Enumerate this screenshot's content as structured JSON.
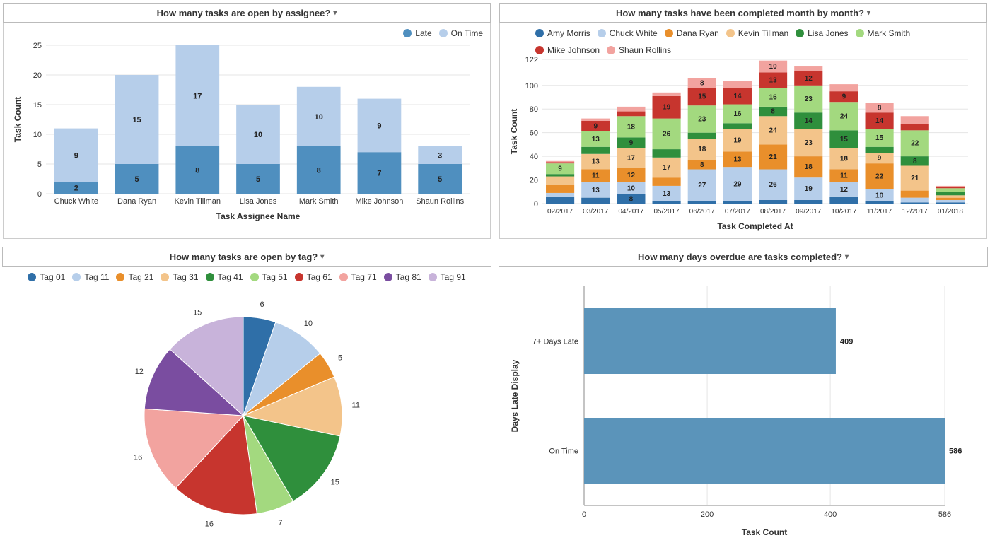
{
  "panels": {
    "byAssignee": {
      "title": "How many tasks are open by assignee?"
    },
    "byMonth": {
      "title": "How many tasks have been completed month by month?"
    },
    "byTag": {
      "title": "How many tasks are open by tag?"
    },
    "overdue": {
      "title": "How many days overdue are tasks completed?"
    }
  },
  "chart_data": [
    {
      "id": "byAssignee",
      "type": "bar-stacked",
      "xlabel": "Task Assignee Name",
      "ylabel": "Task Count",
      "ylim": [
        0,
        25
      ],
      "yticks": [
        0,
        5,
        10,
        15,
        20,
        25
      ],
      "categories": [
        "Chuck White",
        "Dana Ryan",
        "Kevin Tillman",
        "Lisa Jones",
        "Mark Smith",
        "Mike Johnson",
        "Shaun Rollins"
      ],
      "series": [
        {
          "name": "Late",
          "color": "#4f8fbf",
          "values": [
            2,
            5,
            8,
            5,
            8,
            7,
            5
          ]
        },
        {
          "name": "On Time",
          "color": "#b6ceea",
          "values": [
            9,
            15,
            17,
            10,
            10,
            9,
            3
          ]
        }
      ]
    },
    {
      "id": "byMonth",
      "type": "bar-stacked",
      "xlabel": "Task Completed At",
      "ylabel": "Task Count",
      "ylim": [
        0,
        122
      ],
      "yticks": [
        0,
        20,
        40,
        60,
        80,
        100,
        122
      ],
      "categories": [
        "02/2017",
        "03/2017",
        "04/2017",
        "05/2017",
        "06/2017",
        "07/2017",
        "08/2017",
        "09/2017",
        "10/2017",
        "11/2017",
        "12/2017",
        "01/2018"
      ],
      "series": [
        {
          "name": "Amy Morris",
          "color": "#2f6fa8",
          "values": [
            6,
            5,
            8,
            2,
            2,
            2,
            3,
            3,
            6,
            2,
            1,
            1
          ]
        },
        {
          "name": "Chuck White",
          "color": "#b6ceea",
          "values": [
            3,
            13,
            10,
            13,
            27,
            29,
            26,
            19,
            12,
            10,
            4,
            2
          ]
        },
        {
          "name": "Dana Ryan",
          "color": "#e98f2b",
          "values": [
            7,
            11,
            12,
            7,
            8,
            13,
            21,
            18,
            11,
            22,
            6,
            2
          ]
        },
        {
          "name": "Kevin Tillman",
          "color": "#f3c48a",
          "values": [
            7,
            13,
            17,
            17,
            18,
            19,
            24,
            23,
            18,
            9,
            21,
            2
          ]
        },
        {
          "name": "Lisa Jones",
          "color": "#2f8f3c",
          "values": [
            2,
            6,
            9,
            7,
            5,
            5,
            8,
            14,
            15,
            5,
            8,
            3
          ]
        },
        {
          "name": "Mark Smith",
          "color": "#a3d97f",
          "values": [
            9,
            13,
            18,
            26,
            23,
            16,
            16,
            23,
            24,
            15,
            22,
            3
          ]
        },
        {
          "name": "Mike Johnson",
          "color": "#c7352e",
          "values": [
            1,
            9,
            4,
            19,
            15,
            14,
            13,
            12,
            9,
            14,
            5,
            1
          ]
        },
        {
          "name": "Shaun Rollins",
          "color": "#f2a39f",
          "values": [
            1,
            2,
            4,
            3,
            8,
            6,
            10,
            4,
            6,
            8,
            7,
            1
          ]
        }
      ]
    },
    {
      "id": "byTag",
      "type": "pie",
      "series": [
        {
          "name": "Tag 01",
          "color": "#2f6fa8",
          "value": 6
        },
        {
          "name": "Tag 11",
          "color": "#b6ceea",
          "value": 10
        },
        {
          "name": "Tag 21",
          "color": "#e98f2b",
          "value": 5
        },
        {
          "name": "Tag 31",
          "color": "#f3c48a",
          "value": 11
        },
        {
          "name": "Tag 41",
          "color": "#2f8f3c",
          "value": 15
        },
        {
          "name": "Tag 51",
          "color": "#a3d97f",
          "value": 7
        },
        {
          "name": "Tag 61",
          "color": "#c7352e",
          "value": 16
        },
        {
          "name": "Tag 71",
          "color": "#f2a39f",
          "value": 16
        },
        {
          "name": "Tag 81",
          "color": "#7a4da0",
          "value": 12
        },
        {
          "name": "Tag 91",
          "color": "#c8b3da",
          "value": 15
        }
      ]
    },
    {
      "id": "overdue",
      "type": "bar-horizontal",
      "xlabel": "Task Count",
      "ylabel": "Days Late Display",
      "xlim": [
        0,
        586
      ],
      "xticks": [
        0,
        200,
        400,
        586
      ],
      "categories": [
        "7+ Days Late",
        "On Time"
      ],
      "values": [
        409,
        586
      ],
      "color": "#5b94ba"
    }
  ]
}
